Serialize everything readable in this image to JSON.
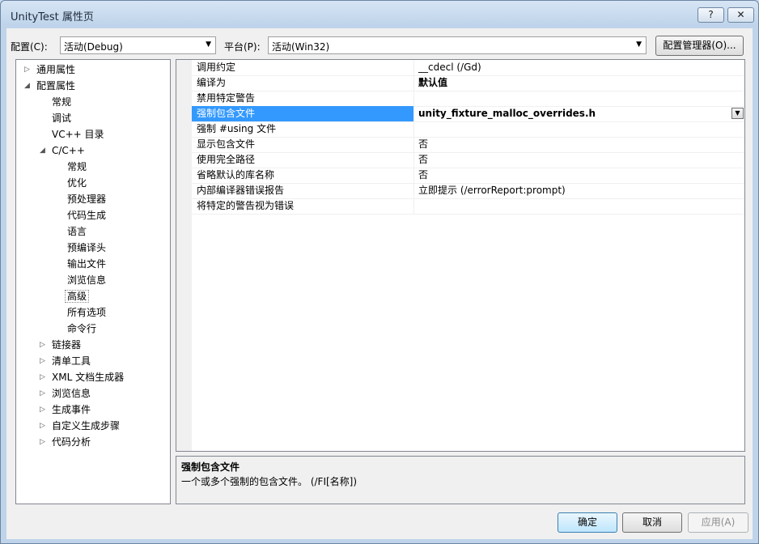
{
  "window": {
    "title": "UnityTest 属性页",
    "help_label": "?",
    "close_label": "✕"
  },
  "config": {
    "label": "配置(C):",
    "value": "活动(Debug)"
  },
  "platform": {
    "label": "平台(P):",
    "value": "活动(Win32)"
  },
  "config_manager_label": "配置管理器(O)...",
  "tree": [
    {
      "label": "通用属性",
      "level": 0,
      "toggle": "▷"
    },
    {
      "label": "配置属性",
      "level": 0,
      "toggle": "◢"
    },
    {
      "label": "常规",
      "level": 1,
      "toggle": ""
    },
    {
      "label": "调试",
      "level": 1,
      "toggle": ""
    },
    {
      "label": "VC++ 目录",
      "level": 1,
      "toggle": ""
    },
    {
      "label": "C/C++",
      "level": 1,
      "toggle": "◢"
    },
    {
      "label": "常规",
      "level": 2,
      "toggle": ""
    },
    {
      "label": "优化",
      "level": 2,
      "toggle": ""
    },
    {
      "label": "预处理器",
      "level": 2,
      "toggle": ""
    },
    {
      "label": "代码生成",
      "level": 2,
      "toggle": ""
    },
    {
      "label": "语言",
      "level": 2,
      "toggle": ""
    },
    {
      "label": "预编译头",
      "level": 2,
      "toggle": ""
    },
    {
      "label": "输出文件",
      "level": 2,
      "toggle": ""
    },
    {
      "label": "浏览信息",
      "level": 2,
      "toggle": ""
    },
    {
      "label": "高级",
      "level": 2,
      "toggle": "",
      "selected": true
    },
    {
      "label": "所有选项",
      "level": 2,
      "toggle": ""
    },
    {
      "label": "命令行",
      "level": 2,
      "toggle": ""
    },
    {
      "label": "链接器",
      "level": 1,
      "toggle": "▷"
    },
    {
      "label": "清单工具",
      "level": 1,
      "toggle": "▷"
    },
    {
      "label": "XML 文档生成器",
      "level": 1,
      "toggle": "▷"
    },
    {
      "label": "浏览信息",
      "level": 1,
      "toggle": "▷"
    },
    {
      "label": "生成事件",
      "level": 1,
      "toggle": "▷"
    },
    {
      "label": "自定义生成步骤",
      "level": 1,
      "toggle": "▷"
    },
    {
      "label": "代码分析",
      "level": 1,
      "toggle": "▷"
    }
  ],
  "properties": [
    {
      "name": "调用约定",
      "value": "__cdecl (/Gd)"
    },
    {
      "name": "编译为",
      "value": "默认值",
      "bold": true
    },
    {
      "name": "禁用特定警告",
      "value": ""
    },
    {
      "name": "强制包含文件",
      "value": "unity_fixture_malloc_overrides.h",
      "bold": true,
      "selected": true
    },
    {
      "name": "强制 #using 文件",
      "value": ""
    },
    {
      "name": "显示包含文件",
      "value": "否"
    },
    {
      "name": "使用完全路径",
      "value": "否"
    },
    {
      "name": "省略默认的库名称",
      "value": "否"
    },
    {
      "name": "内部编译器错误报告",
      "value": "立即提示 (/errorReport:prompt)"
    },
    {
      "name": "将特定的警告视为错误",
      "value": ""
    }
  ],
  "description": {
    "title": "强制包含文件",
    "text": "一个或多个强制的包含文件。     (/FI[名称])"
  },
  "buttons": {
    "ok": "确定",
    "cancel": "取消",
    "apply": "应用(A)"
  },
  "icons": {
    "expand": "chevron-right-icon",
    "collapse": "triangle-down-icon",
    "dropdown": "dropdown-arrow-icon"
  }
}
